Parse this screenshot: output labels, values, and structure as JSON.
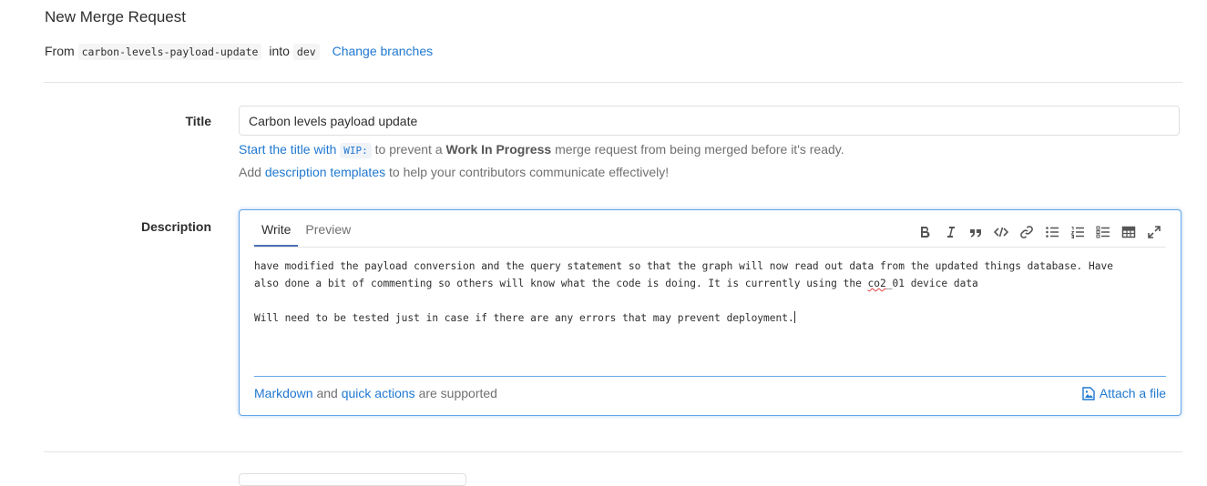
{
  "header": {
    "title": "New Merge Request",
    "from_label": "From",
    "source_branch": "carbon-levels-payload-update",
    "into_label": "into",
    "target_branch": "dev",
    "change_branches": "Change branches"
  },
  "title_field": {
    "label": "Title",
    "value": "Carbon levels payload update"
  },
  "wip_hint": {
    "prefix": "Start the title with",
    "code": "WIP:",
    "middle": "to prevent a",
    "bold": "Work In Progress",
    "suffix": "merge request from being merged before it's ready."
  },
  "templates_hint": {
    "prefix": "Add",
    "link": "description templates",
    "suffix": "to help your contributors communicate effectively!"
  },
  "description": {
    "label": "Description",
    "tabs": [
      "Write",
      "Preview"
    ],
    "active_tab": "Write",
    "toolbar_icons": [
      "bold-icon",
      "italic-icon",
      "quote-icon",
      "code-icon",
      "link-icon",
      "bulleted-list-icon",
      "numbered-list-icon",
      "task-list-icon",
      "table-icon",
      "fullscreen-icon"
    ],
    "line1a": "have modified the payload conversion and the query statement so that the graph will now read out data from the updated things database. Have",
    "line1b_pre": "also done a bit of commenting so others will know what the code is doing. It is currently using the ",
    "line1b_word": "co2",
    "line1b_post": "_01 device data",
    "line2": "Will need to be tested just in case if there are any errors that may prevent deployment.",
    "footer_link1": "Markdown",
    "footer_and": "and",
    "footer_link2": "quick actions",
    "footer_suffix": "are supported",
    "attach_label": "Attach a file"
  },
  "colors": {
    "link": "#1f78d1",
    "focus_border": "#63a6e9",
    "active_tab_underline": "#4a70b8"
  }
}
